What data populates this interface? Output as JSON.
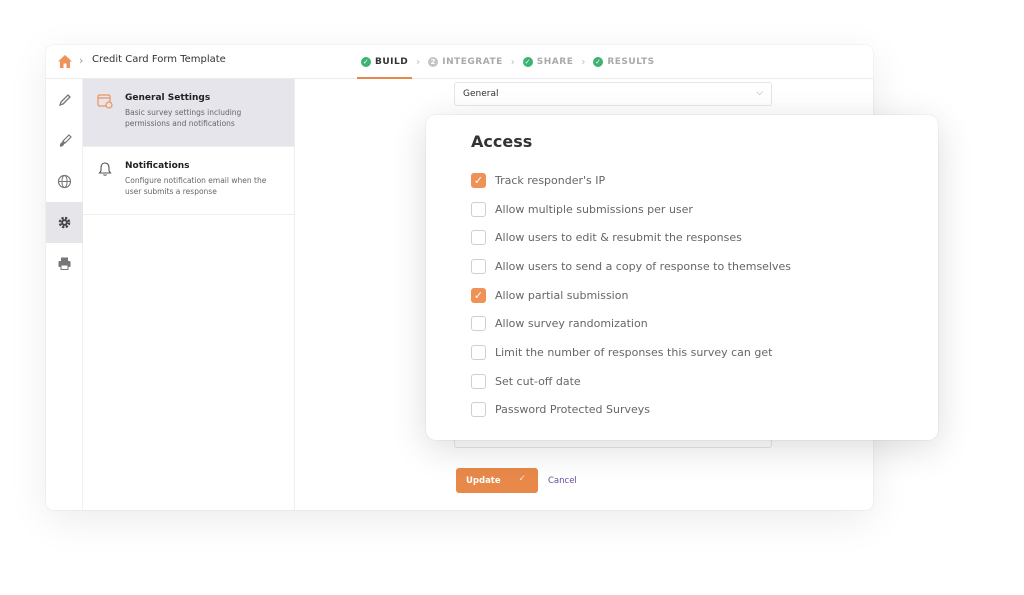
{
  "header": {
    "form_title": "Credit Card Form Template",
    "steps": [
      {
        "label": "BUILD",
        "state": "done",
        "active": true
      },
      {
        "label": "INTEGRATE",
        "state": "numbered",
        "number": "2",
        "active": false
      },
      {
        "label": "SHARE",
        "state": "done",
        "active": false
      },
      {
        "label": "RESULTS",
        "state": "done",
        "active": false
      }
    ]
  },
  "rail": {
    "items": [
      {
        "icon": "pencil-icon",
        "active": false
      },
      {
        "icon": "paintbrush-icon",
        "active": false
      },
      {
        "icon": "globe-icon",
        "active": false
      },
      {
        "icon": "gear-icon",
        "active": true
      },
      {
        "icon": "printer-icon",
        "active": false
      }
    ]
  },
  "settings": {
    "items": [
      {
        "title": "General Settings",
        "description": "Basic survey settings including permissions and notifications",
        "icon": "settings-window-icon",
        "active": true
      },
      {
        "title": "Notifications",
        "description": "Configure notification email when the user submits a response",
        "icon": "bell-icon",
        "active": false
      }
    ]
  },
  "main": {
    "select_value": "General",
    "update_label": "Update",
    "cancel_label": "Cancel"
  },
  "access": {
    "title": "Access",
    "options": [
      {
        "label": "Track responder's IP",
        "checked": true
      },
      {
        "label": "Allow multiple submissions per user",
        "checked": false
      },
      {
        "label": "Allow users to edit & resubmit the responses",
        "checked": false
      },
      {
        "label": "Allow users to send a copy of response to themselves",
        "checked": false
      },
      {
        "label": "Allow partial submission",
        "checked": true
      },
      {
        "label": "Allow survey randomization",
        "checked": false
      },
      {
        "label": "Limit the number of responses this survey can get",
        "checked": false
      },
      {
        "label": "Set cut-off date",
        "checked": false
      },
      {
        "label": "Password Protected Surveys",
        "checked": false
      }
    ]
  },
  "colors": {
    "accent": "#e8894a",
    "checkbox_on": "#ee9257",
    "step_done": "#3cb371",
    "cancel_link": "#6a4c9c"
  }
}
